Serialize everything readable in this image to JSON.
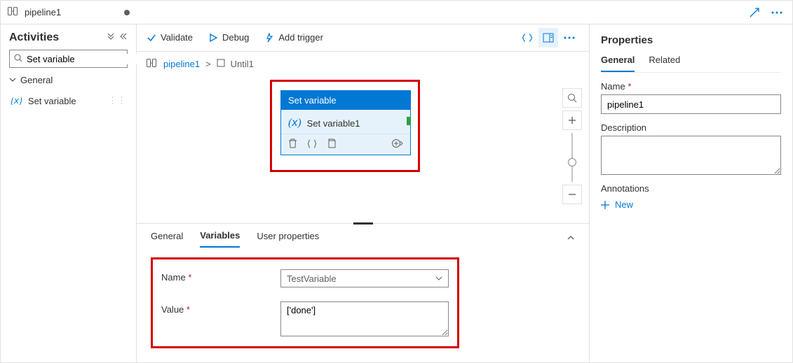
{
  "tab": {
    "title": "pipeline1"
  },
  "sidebar": {
    "title": "Activities",
    "search_placeholder": "Set variable",
    "group_label": "General",
    "items": [
      {
        "label": "Set variable"
      }
    ]
  },
  "toolbar": {
    "validate": "Validate",
    "debug": "Debug",
    "add_trigger": "Add trigger"
  },
  "breadcrumb": {
    "root": "pipeline1",
    "sep": ">",
    "child": "Until1"
  },
  "node": {
    "type_label": "Set variable",
    "name": "Set variable1"
  },
  "bottom": {
    "tabs": {
      "general": "General",
      "variables": "Variables",
      "user_props": "User properties"
    },
    "fields": {
      "name_label": "Name",
      "name_value": "TestVariable",
      "value_label": "Value",
      "value_value": "['done']"
    }
  },
  "props": {
    "title": "Properties",
    "tabs": {
      "general": "General",
      "related": "Related"
    },
    "name_label": "Name",
    "name_value": "pipeline1",
    "desc_label": "Description",
    "ann_label": "Annotations",
    "new_label": "New"
  }
}
